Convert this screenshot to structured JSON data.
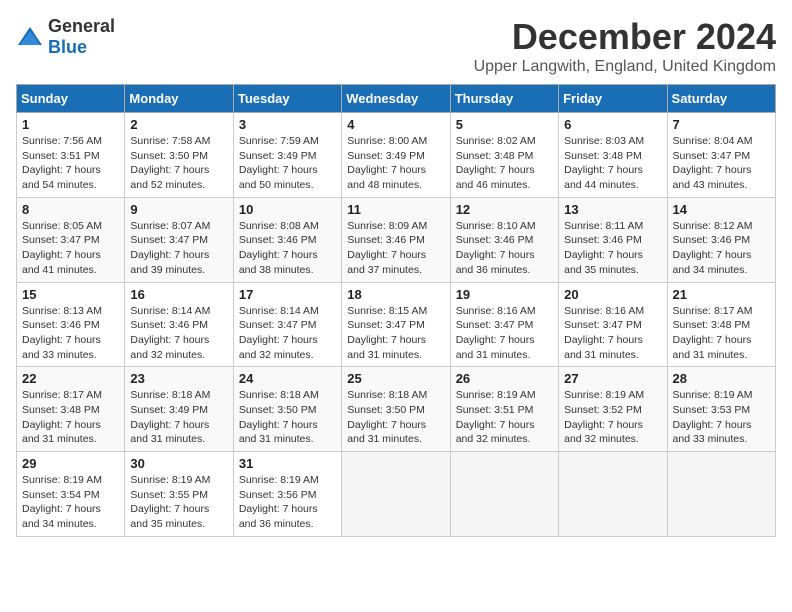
{
  "logo": {
    "general": "General",
    "blue": "Blue"
  },
  "title": "December 2024",
  "subtitle": "Upper Langwith, England, United Kingdom",
  "weekdays": [
    "Sunday",
    "Monday",
    "Tuesday",
    "Wednesday",
    "Thursday",
    "Friday",
    "Saturday"
  ],
  "weeks": [
    [
      {
        "day": "1",
        "sunrise": "7:56 AM",
        "sunset": "3:51 PM",
        "daylight": "7 hours and 54 minutes."
      },
      {
        "day": "2",
        "sunrise": "7:58 AM",
        "sunset": "3:50 PM",
        "daylight": "7 hours and 52 minutes."
      },
      {
        "day": "3",
        "sunrise": "7:59 AM",
        "sunset": "3:49 PM",
        "daylight": "7 hours and 50 minutes."
      },
      {
        "day": "4",
        "sunrise": "8:00 AM",
        "sunset": "3:49 PM",
        "daylight": "7 hours and 48 minutes."
      },
      {
        "day": "5",
        "sunrise": "8:02 AM",
        "sunset": "3:48 PM",
        "daylight": "7 hours and 46 minutes."
      },
      {
        "day": "6",
        "sunrise": "8:03 AM",
        "sunset": "3:48 PM",
        "daylight": "7 hours and 44 minutes."
      },
      {
        "day": "7",
        "sunrise": "8:04 AM",
        "sunset": "3:47 PM",
        "daylight": "7 hours and 43 minutes."
      }
    ],
    [
      {
        "day": "8",
        "sunrise": "8:05 AM",
        "sunset": "3:47 PM",
        "daylight": "7 hours and 41 minutes."
      },
      {
        "day": "9",
        "sunrise": "8:07 AM",
        "sunset": "3:47 PM",
        "daylight": "7 hours and 39 minutes."
      },
      {
        "day": "10",
        "sunrise": "8:08 AM",
        "sunset": "3:46 PM",
        "daylight": "7 hours and 38 minutes."
      },
      {
        "day": "11",
        "sunrise": "8:09 AM",
        "sunset": "3:46 PM",
        "daylight": "7 hours and 37 minutes."
      },
      {
        "day": "12",
        "sunrise": "8:10 AM",
        "sunset": "3:46 PM",
        "daylight": "7 hours and 36 minutes."
      },
      {
        "day": "13",
        "sunrise": "8:11 AM",
        "sunset": "3:46 PM",
        "daylight": "7 hours and 35 minutes."
      },
      {
        "day": "14",
        "sunrise": "8:12 AM",
        "sunset": "3:46 PM",
        "daylight": "7 hours and 34 minutes."
      }
    ],
    [
      {
        "day": "15",
        "sunrise": "8:13 AM",
        "sunset": "3:46 PM",
        "daylight": "7 hours and 33 minutes."
      },
      {
        "day": "16",
        "sunrise": "8:14 AM",
        "sunset": "3:46 PM",
        "daylight": "7 hours and 32 minutes."
      },
      {
        "day": "17",
        "sunrise": "8:14 AM",
        "sunset": "3:47 PM",
        "daylight": "7 hours and 32 minutes."
      },
      {
        "day": "18",
        "sunrise": "8:15 AM",
        "sunset": "3:47 PM",
        "daylight": "7 hours and 31 minutes."
      },
      {
        "day": "19",
        "sunrise": "8:16 AM",
        "sunset": "3:47 PM",
        "daylight": "7 hours and 31 minutes."
      },
      {
        "day": "20",
        "sunrise": "8:16 AM",
        "sunset": "3:47 PM",
        "daylight": "7 hours and 31 minutes."
      },
      {
        "day": "21",
        "sunrise": "8:17 AM",
        "sunset": "3:48 PM",
        "daylight": "7 hours and 31 minutes."
      }
    ],
    [
      {
        "day": "22",
        "sunrise": "8:17 AM",
        "sunset": "3:48 PM",
        "daylight": "7 hours and 31 minutes."
      },
      {
        "day": "23",
        "sunrise": "8:18 AM",
        "sunset": "3:49 PM",
        "daylight": "7 hours and 31 minutes."
      },
      {
        "day": "24",
        "sunrise": "8:18 AM",
        "sunset": "3:50 PM",
        "daylight": "7 hours and 31 minutes."
      },
      {
        "day": "25",
        "sunrise": "8:18 AM",
        "sunset": "3:50 PM",
        "daylight": "7 hours and 31 minutes."
      },
      {
        "day": "26",
        "sunrise": "8:19 AM",
        "sunset": "3:51 PM",
        "daylight": "7 hours and 32 minutes."
      },
      {
        "day": "27",
        "sunrise": "8:19 AM",
        "sunset": "3:52 PM",
        "daylight": "7 hours and 32 minutes."
      },
      {
        "day": "28",
        "sunrise": "8:19 AM",
        "sunset": "3:53 PM",
        "daylight": "7 hours and 33 minutes."
      }
    ],
    [
      {
        "day": "29",
        "sunrise": "8:19 AM",
        "sunset": "3:54 PM",
        "daylight": "7 hours and 34 minutes."
      },
      {
        "day": "30",
        "sunrise": "8:19 AM",
        "sunset": "3:55 PM",
        "daylight": "7 hours and 35 minutes."
      },
      {
        "day": "31",
        "sunrise": "8:19 AM",
        "sunset": "3:56 PM",
        "daylight": "7 hours and 36 minutes."
      },
      null,
      null,
      null,
      null
    ]
  ]
}
